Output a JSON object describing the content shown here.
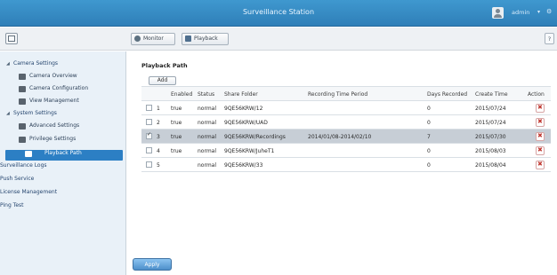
{
  "app": {
    "title": "Surveillance Station",
    "user": "admin",
    "caret": "▾",
    "help": "?"
  },
  "toolbar": {
    "monitor_label": "Monitor",
    "playback_label": "Playback"
  },
  "sidebar": {
    "items": [
      {
        "label": "Camera Settings",
        "level": "group",
        "expanded": true
      },
      {
        "label": "Camera Overview",
        "level": "child"
      },
      {
        "label": "Camera Configuration",
        "level": "child"
      },
      {
        "label": "View Management",
        "level": "child"
      },
      {
        "label": "System Settings",
        "level": "group",
        "expanded": true
      },
      {
        "label": "Advanced Settings",
        "level": "child"
      },
      {
        "label": "Privilege Settings",
        "level": "child"
      },
      {
        "label": "Playback Path",
        "level": "child",
        "active": true
      },
      {
        "label": "Surveillance Logs",
        "level": "group"
      },
      {
        "label": "Push Service",
        "level": "group"
      },
      {
        "label": "License Management",
        "level": "group"
      },
      {
        "label": "Ping Test",
        "level": "group"
      }
    ]
  },
  "main": {
    "heading": "Playback Path",
    "add_label": "Add",
    "apply_label": "Apply",
    "table": {
      "columns": [
        "Enabled",
        "Status",
        "Share Folder",
        "Recording Time Period",
        "Days Recorded",
        "Create Time",
        "Action"
      ],
      "rows": [
        {
          "index": "1",
          "enabled": "true",
          "status": "normal",
          "share_folder": "9QE56KRW/12",
          "recording_time_period": "",
          "days_recorded": "0",
          "create_time": "2015/07/24"
        },
        {
          "index": "2",
          "enabled": "true",
          "status": "normal",
          "share_folder": "9QE56KRW/UAD",
          "recording_time_period": "",
          "days_recorded": "0",
          "create_time": "2015/07/24"
        },
        {
          "index": "3",
          "enabled": "true",
          "status": "normal",
          "share_folder": "9QE56KRW/Recordings",
          "recording_time_period": "2014/01/08-2014/02/10",
          "days_recorded": "7",
          "create_time": "2015/07/30",
          "selected": true
        },
        {
          "index": "4",
          "enabled": "true",
          "status": "normal",
          "share_folder": "9QE56KRW/JuheT1",
          "recording_time_period": "",
          "days_recorded": "0",
          "create_time": "2015/08/03"
        },
        {
          "index": "5",
          "enabled": "",
          "status": "normal",
          "share_folder": "9QE56KRW/33",
          "recording_time_period": "",
          "days_recorded": "0",
          "create_time": "2015/08/04"
        }
      ]
    }
  }
}
